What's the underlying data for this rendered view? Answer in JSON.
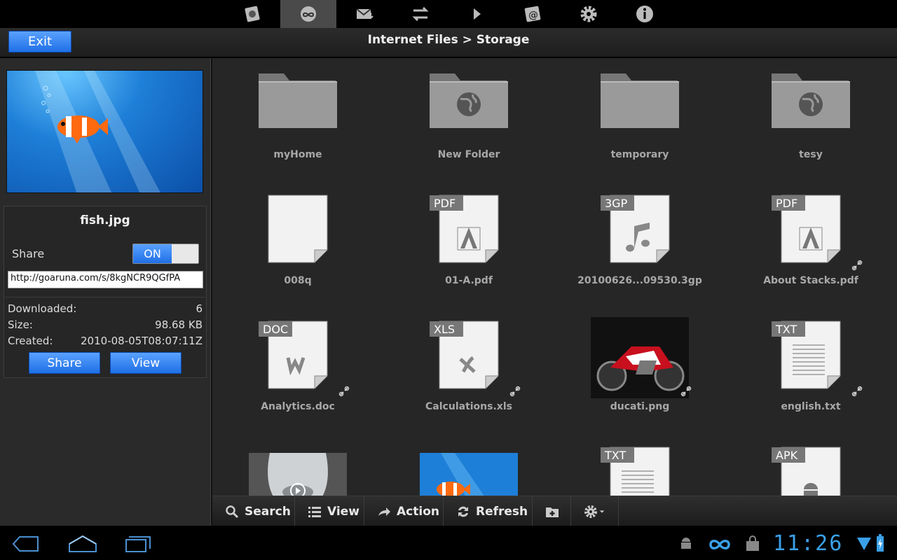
{
  "top_tabs": [
    {
      "name": "device-tab",
      "icon": "hard-drive-icon",
      "active": false
    },
    {
      "name": "cloud-tab",
      "icon": "infinity-cloud-icon",
      "active": true
    },
    {
      "name": "inbox-tab",
      "icon": "mail-download-icon",
      "active": false
    },
    {
      "name": "transfers-tab",
      "icon": "transfer-arrows-icon",
      "active": false
    },
    {
      "name": "play-tab",
      "icon": "play-icon",
      "active": false
    },
    {
      "name": "contacts-tab",
      "icon": "at-sign-icon",
      "active": false
    },
    {
      "name": "settings-tab",
      "icon": "gear-icon",
      "active": false
    },
    {
      "name": "info-tab",
      "icon": "info-icon",
      "active": false
    }
  ],
  "header": {
    "exit_label": "Exit",
    "breadcrumb": "Internet Files > Storage"
  },
  "details": {
    "file_name": "fish.jpg",
    "share_label": "Share",
    "toggle_label": "ON",
    "share_url": "http://goaruna.com/s/8kgNCR9QGfPA",
    "downloaded_label": "Downloaded:",
    "downloaded_value": "6",
    "size_label": "Size:",
    "size_value": "98.68 KB",
    "created_label": "Created:",
    "created_value": "2010-08-05T08:07:11Z",
    "share_button": "Share",
    "view_button": "View"
  },
  "files": [
    {
      "label": "myHome",
      "kind": "folder",
      "linked": false
    },
    {
      "label": "New Folder",
      "kind": "globe-folder",
      "linked": false
    },
    {
      "label": "temporary",
      "kind": "folder",
      "linked": false
    },
    {
      "label": "tesy",
      "kind": "globe-folder",
      "linked": false
    },
    {
      "label": "008q",
      "kind": "blank",
      "tag": "",
      "linked": false
    },
    {
      "label": "01-A.pdf",
      "kind": "doc",
      "tag": "PDF",
      "linked": false
    },
    {
      "label": "20100626...09530.3gp",
      "kind": "doc",
      "tag": "3GP",
      "linked": false
    },
    {
      "label": "About Stacks.pdf",
      "kind": "doc",
      "tag": "PDF",
      "linked": true
    },
    {
      "label": "Analytics.doc",
      "kind": "doc",
      "tag": "DOC",
      "linked": true
    },
    {
      "label": "Calculations.xls",
      "kind": "doc",
      "tag": "XLS",
      "linked": true
    },
    {
      "label": "ducati.png",
      "kind": "image-moto",
      "linked": true
    },
    {
      "label": "english.txt",
      "kind": "doc",
      "tag": "TXT",
      "linked": true
    },
    {
      "label": "",
      "kind": "image-face",
      "linked": false
    },
    {
      "label": "",
      "kind": "image-fish",
      "linked": false
    },
    {
      "label": "",
      "kind": "doc",
      "tag": "TXT",
      "linked": false
    },
    {
      "label": "",
      "kind": "doc",
      "tag": "APK",
      "linked": false
    }
  ],
  "toolbar": {
    "search": "Search",
    "view": "View",
    "action": "Action",
    "refresh": "Refresh"
  },
  "system": {
    "clock": "11:26"
  },
  "colors": {
    "accent_blue": "#1f6fe6",
    "clock_blue": "#3aa0e8",
    "panel_bg": "#262626"
  }
}
